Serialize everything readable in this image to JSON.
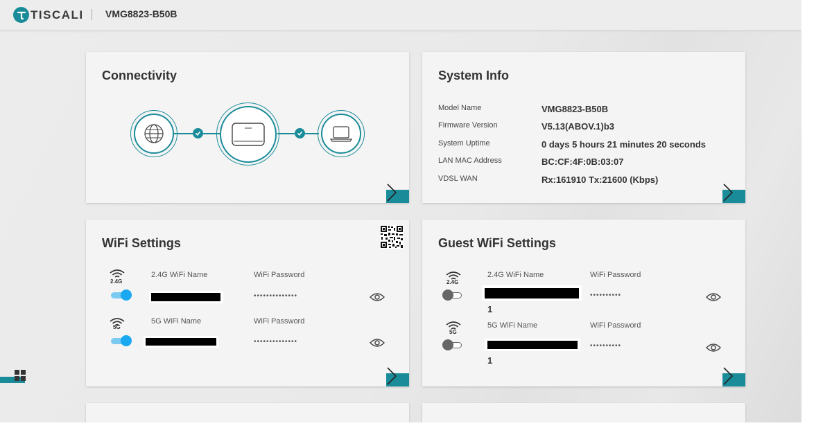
{
  "header": {
    "brand": "TISCALI",
    "model": "VMG8823-B50B"
  },
  "connectivity": {
    "title": "Connectivity",
    "icons": [
      "globe-icon",
      "router-icon",
      "laptop-icon"
    ]
  },
  "system_info": {
    "title": "System Info",
    "rows": [
      {
        "label": "Model Name",
        "value": "VMG8823-B50B"
      },
      {
        "label": "Firmware Version",
        "value": "V5.13(ABOV.1)b3"
      },
      {
        "label": "System Uptime",
        "value": "0 days 5 hours 21 minutes 20 seconds"
      },
      {
        "label": "LAN MAC Address",
        "value": "BC:CF:4F:0B:03:07"
      },
      {
        "label": "VDSL WAN",
        "value": "Rx:161910 Tx:21600 (Kbps)"
      }
    ]
  },
  "wifi": {
    "title": "WiFi Settings",
    "bands": [
      {
        "band": "2.4G",
        "name_label": "2.4G WiFi Name",
        "password_label": "WiFi Password",
        "password": "••••••••••••••",
        "enabled": true
      },
      {
        "band": "5G",
        "name_label": "5G WiFi Name",
        "password_label": "WiFi Password",
        "password": "••••••••••••••",
        "enabled": true
      }
    ]
  },
  "guest_wifi": {
    "title": "Guest WiFi Settings",
    "bands": [
      {
        "band": "2.4G",
        "name_label": "2.4G WiFi Name",
        "password_label": "WiFi Password",
        "password": "••••••••••",
        "enabled": false,
        "suffix": "1"
      },
      {
        "band": "5G",
        "name_label": "5G WiFi Name",
        "password_label": "WiFi Password",
        "password": "••••••••••",
        "enabled": false,
        "suffix": "1"
      }
    ]
  },
  "colors": {
    "accent": "#1a8c99",
    "toggle_on": "#1aa8f0"
  }
}
